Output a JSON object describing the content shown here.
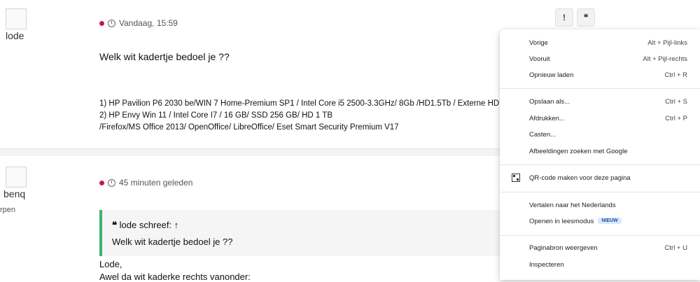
{
  "post1": {
    "author": "lode",
    "timestamp": "Vandaag, 15:59",
    "message": "Welk wit kadertje bedoel je ??",
    "signature": [
      "1) HP Pavilion P6 2030 be/WIN 7 Home-Premium SP1 / Intel Core i5 2500-3.3GHz/ 8Gb /HD1.5Tb / Externe HD",
      "2) HP Envy Win 11 / Intel Core I7 / 16 GB/ SSD 256 GB/ HD 1 TB",
      "/Firefox/MS Office 2013/ OpenOffice/ LibreOffice/ Eset Smart Security Premium V17"
    ],
    "report_label": "!",
    "quote_label": "❝"
  },
  "post2": {
    "author": "benq",
    "author_sub": "rpen",
    "timestamp": "45 minuten geleden",
    "quote_header": "lode schreef: ↑",
    "quote_text": "Welk wit kadertje bedoel je ??",
    "reply_lines": [
      "Lode,",
      "Awel da wit kaderke rechts vanonder:"
    ]
  },
  "context_menu": {
    "items": [
      {
        "label": "Vorige",
        "shortcut": "Alt + Pijl-links"
      },
      {
        "label": "Vooruit",
        "shortcut": "Alt + Pijl-rechts"
      },
      {
        "label": "Opnieuw laden",
        "shortcut": "Ctrl + R"
      },
      {
        "label": "Opslaan als...",
        "shortcut": "Ctrl + S"
      },
      {
        "label": "Afdrukken...",
        "shortcut": "Ctrl + P"
      },
      {
        "label": "Casten...",
        "shortcut": ""
      },
      {
        "label": "Afbeeldingen zoeken met Google",
        "shortcut": ""
      },
      {
        "label": "QR-code maken voor deze pagina",
        "shortcut": "",
        "icon": "qr-code-icon"
      },
      {
        "label": "Vertalen naar het Nederlands",
        "shortcut": ""
      },
      {
        "label": "Openen in leesmodus",
        "shortcut": "",
        "badge": "NIEUW"
      },
      {
        "label": "Paginabron weergeven",
        "shortcut": "Ctrl + U"
      },
      {
        "label": "Inspecteren",
        "shortcut": ""
      }
    ]
  },
  "colors": {
    "status_dot": "#c2185b",
    "quote_border": "#3cb371",
    "badge_bg": "#dbe7fb"
  }
}
